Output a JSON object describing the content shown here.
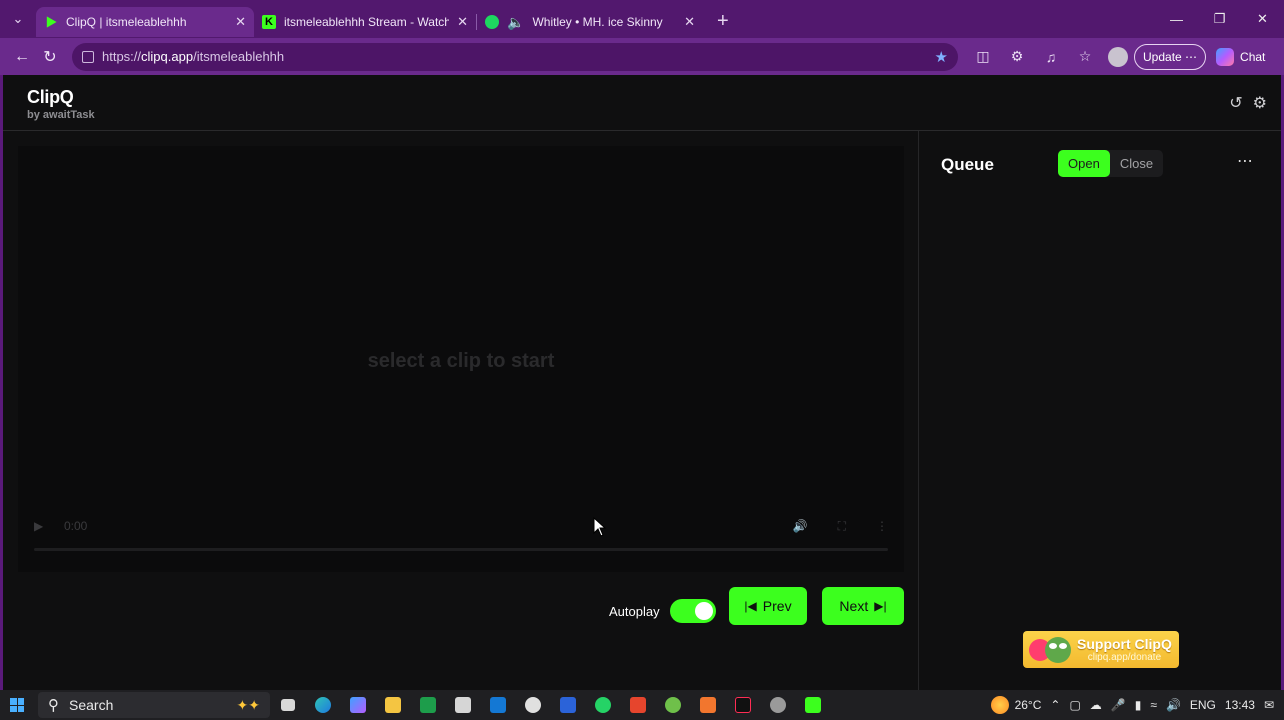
{
  "browser": {
    "tabs": [
      {
        "title": "ClipQ | itsmeleablehhh",
        "favicon": "clipq-icon",
        "active": true
      },
      {
        "title": "itsmeleablehhh Stream - Watch Li…",
        "favicon": "kick-icon",
        "active": false
      },
      {
        "title": "Whitley • MH. ice Skinny",
        "favicon": "spotify-icon",
        "active": false
      }
    ],
    "url_prefix": "https://",
    "url_host": "clipq.app",
    "url_path": "/itsmeleablehhh",
    "update_label": "Update ⋯",
    "chat_label": "Chat"
  },
  "app": {
    "brand_name": "ClipQ",
    "brand_by": "by awaitTask",
    "player": {
      "empty_message": "select a clip to start",
      "time": "0:00"
    },
    "autoplay_label": "Autoplay",
    "autoplay_on": true,
    "prev_label": "Prev",
    "next_label": "Next",
    "queue": {
      "title": "Queue",
      "open_label": "Open",
      "close_label": "Close"
    },
    "support": {
      "line1": "Support ClipQ",
      "line2": "clipq.app/donate"
    },
    "accent_color": "#3cff1e"
  },
  "taskbar": {
    "search_label": "Search",
    "temperature": "26°C",
    "language": "ENG",
    "time": "13:43"
  }
}
